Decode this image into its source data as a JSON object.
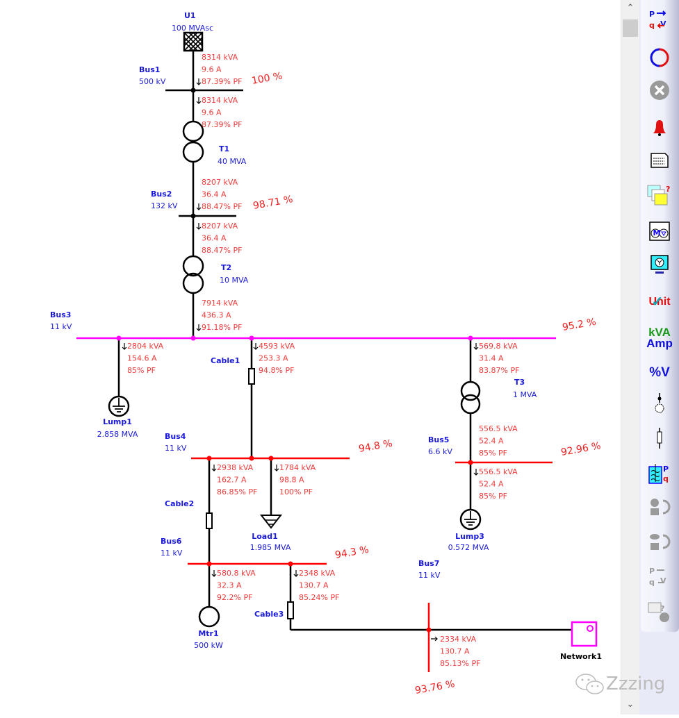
{
  "colors": {
    "name_text": "#1a1ad8",
    "result_text": "#f03a3a",
    "bus_high": "#000000",
    "bus_11kv": "#ff00ff",
    "bus_low": "#ff0000",
    "network": "#ff00ff"
  },
  "sources": [
    {
      "name": "U1",
      "rating": "100 MVAsc"
    }
  ],
  "buses": [
    {
      "name": "Bus1",
      "kv": "500 kV",
      "voltage": "100 %"
    },
    {
      "name": "Bus2",
      "kv": "132 kV",
      "voltage": "98.71 %"
    },
    {
      "name": "Bus3",
      "kv": "11 kV",
      "voltage": "95.2 %"
    },
    {
      "name": "Bus4",
      "kv": "11 kV",
      "voltage": "94.8 %"
    },
    {
      "name": "Bus5",
      "kv": "6.6 kV",
      "voltage": "92.96 %"
    },
    {
      "name": "Bus6",
      "kv": "11 kV",
      "voltage": "94.3 %"
    },
    {
      "name": "Bus7",
      "kv": "11 kV",
      "voltage": "93.76 %"
    }
  ],
  "transformers": [
    {
      "name": "T1",
      "rating": "40 MVA"
    },
    {
      "name": "T2",
      "rating": "10 MVA"
    },
    {
      "name": "T3",
      "rating": "1 MVA"
    }
  ],
  "cables": [
    {
      "name": "Cable1"
    },
    {
      "name": "Cable2"
    },
    {
      "name": "Cable3"
    }
  ],
  "loads": [
    {
      "name": "Lump1",
      "rating": "2.858 MVA"
    },
    {
      "name": "Load1",
      "rating": "1.985 MVA"
    },
    {
      "name": "Lump3",
      "rating": "0.572 MVA"
    },
    {
      "name": "Mtr1",
      "rating": "500 kW"
    }
  ],
  "network": {
    "name": "Network1"
  },
  "flows": [
    {
      "kva": "8314 kVA",
      "amps": "9.6 A",
      "pf": "87.39% PF"
    },
    {
      "kva": "8314 kVA",
      "amps": "9.6 A",
      "pf": "87.39% PF"
    },
    {
      "kva": "8207 kVA",
      "amps": "36.4 A",
      "pf": "88.47% PF"
    },
    {
      "kva": "8207 kVA",
      "amps": "36.4 A",
      "pf": "88.47% PF"
    },
    {
      "kva": "7914 kVA",
      "amps": "436.3 A",
      "pf": "91.18% PF"
    },
    {
      "kva": "2804 kVA",
      "amps": "154.6 A",
      "pf": "85% PF"
    },
    {
      "kva": "4593 kVA",
      "amps": "253.3 A",
      "pf": "94.8% PF"
    },
    {
      "kva": "569.8 kVA",
      "amps": "31.4 A",
      "pf": "83.87% PF"
    },
    {
      "kva": "556.5 kVA",
      "amps": "52.4 A",
      "pf": "85% PF"
    },
    {
      "kva": "556.5 kVA",
      "amps": "52.4 A",
      "pf": "85% PF"
    },
    {
      "kva": "2938 kVA",
      "amps": "162.7 A",
      "pf": "86.85% PF"
    },
    {
      "kva": "1784 kVA",
      "amps": "98.8 A",
      "pf": "100% PF"
    },
    {
      "kva": "580.8 kVA",
      "amps": "32.3 A",
      "pf": "92.2% PF"
    },
    {
      "kva": "2348 kVA",
      "amps": "130.7 A",
      "pf": "85.24% PF"
    },
    {
      "kva": "2334 kVA",
      "amps": "130.7 A",
      "pf": "85.13% PF"
    }
  ],
  "toolbar": {
    "items": [
      {
        "icon": "load-flow-pqv-icon",
        "enabled": true
      },
      {
        "icon": "run-cycle-icon",
        "enabled": true
      },
      {
        "icon": "stop-icon",
        "enabled": false
      },
      {
        "icon": "alarm-bell-icon",
        "enabled": true
      },
      {
        "icon": "report-icon",
        "enabled": true
      },
      {
        "icon": "report-manager-icon",
        "enabled": true
      },
      {
        "icon": "motor-load-icon",
        "enabled": true
      },
      {
        "icon": "monitor-icon",
        "enabled": true
      },
      {
        "icon": "unit-check-icon",
        "enabled": true,
        "label": "Unit"
      },
      {
        "icon": "kva-amp-icon",
        "enabled": true,
        "label": "kVA",
        "label2": "Amp"
      },
      {
        "icon": "percent-voltage-icon",
        "enabled": true,
        "label": "%V"
      },
      {
        "icon": "bus-node-icon",
        "enabled": true
      },
      {
        "icon": "branch-icon",
        "enabled": true
      },
      {
        "icon": "pq-tank-icon",
        "enabled": true
      },
      {
        "icon": "compare-icon",
        "enabled": false
      },
      {
        "icon": "compare-db-icon",
        "enabled": false
      },
      {
        "icon": "pqv-gray-icon",
        "enabled": false
      },
      {
        "icon": "help-report-icon",
        "enabled": false
      }
    ]
  },
  "watermark": {
    "text": "Zzzing"
  }
}
